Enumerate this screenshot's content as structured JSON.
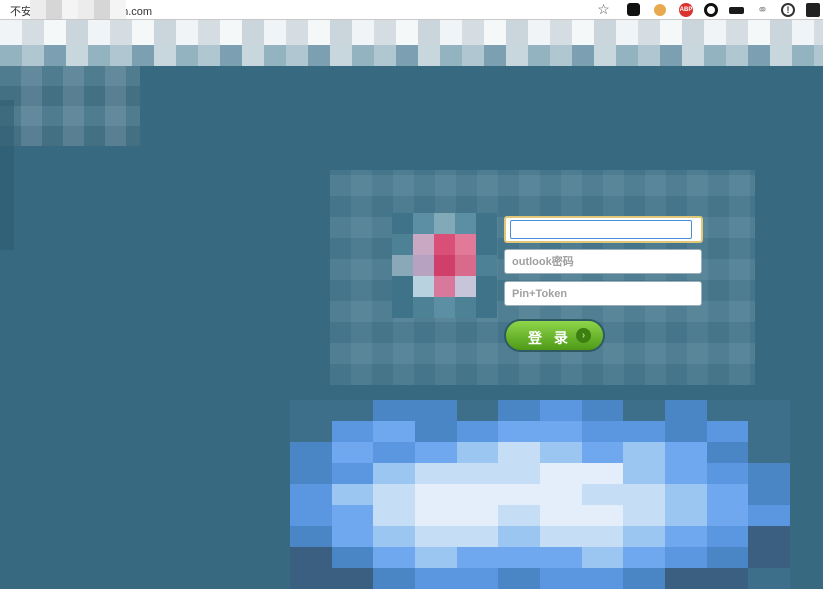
{
  "browser": {
    "url_prefix": "不安",
    "url_suffix": "dn.com",
    "bookmark_icon": "star-icon",
    "extensions": [
      "ext-tab-icon",
      "cookie-icon",
      "adblock-icon",
      "circle-icon",
      "glasses-icon",
      "link-icon",
      "info-icon",
      "profile-icon"
    ],
    "adblock_label": "ABP",
    "info_label": "!"
  },
  "login": {
    "username_value": "",
    "password_placeholder": "outlook密码",
    "pin_placeholder": "Pin+Token",
    "submit_label": "登 录",
    "submit_arrow": "›"
  },
  "colors": {
    "background": "#376980",
    "button_green": "#6dbb2e",
    "focus_outline": "#4a90d9"
  }
}
